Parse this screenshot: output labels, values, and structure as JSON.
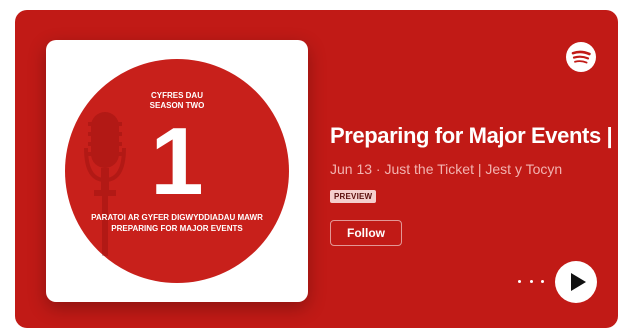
{
  "cover": {
    "series_line": "CYFRES DAU",
    "season_line": "SEASON TWO",
    "number": "1",
    "subtitle_line1": "PARATOI AR GYFER DIGWYDDIADAU MAWR",
    "subtitle_line2": "PREPARING FOR MAJOR EVENTS"
  },
  "episode": {
    "title": "Preparing for Major Events |",
    "meta": "Jun 13 · Just the Ticket | Jest y Tocyn",
    "badge": "PREVIEW"
  },
  "actions": {
    "follow_label": "Follow"
  },
  "icons": {
    "brand": "spotify-icon",
    "more": "more-options-icon",
    "play": "play-icon"
  },
  "colors": {
    "background": "#c11a16",
    "cover_circle": "#c8201b",
    "meta_text": "#f2b3b0",
    "badge_bg": "#f5cfcd"
  }
}
